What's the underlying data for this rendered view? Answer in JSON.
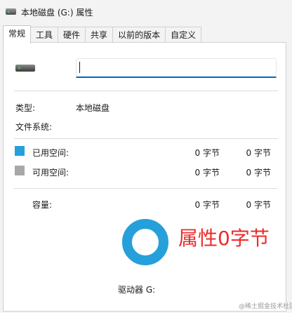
{
  "window": {
    "title": "本地磁盘 (G:) 属性"
  },
  "tabs": [
    {
      "label": "常规",
      "active": true
    },
    {
      "label": "工具",
      "active": false
    },
    {
      "label": "硬件",
      "active": false
    },
    {
      "label": "共享",
      "active": false
    },
    {
      "label": "以前的版本",
      "active": false
    },
    {
      "label": "自定义",
      "active": false
    }
  ],
  "general": {
    "name_value": "",
    "type_label": "类型:",
    "type_value": "本地磁盘",
    "fs_label": "文件系统:",
    "fs_value": "",
    "used": {
      "label": "已用空间:",
      "bytes": "0 字节",
      "size": "0 字节",
      "color": "#26a0da"
    },
    "free": {
      "label": "可用空间:",
      "bytes": "0 字节",
      "size": "0 字节",
      "color": "#a8a8a8"
    },
    "capacity": {
      "label": "容量:",
      "bytes": "0 字节",
      "size": "0 字节"
    },
    "drive_label": "驱动器 G:",
    "usage_fraction": 0
  },
  "annotation": {
    "text": "属性0字节",
    "color": "#ee2a2a"
  },
  "watermark": {
    "text": "@稀土掘金技术社区"
  },
  "colors": {
    "accent": "#0067c0",
    "donut": "#26a0da"
  }
}
